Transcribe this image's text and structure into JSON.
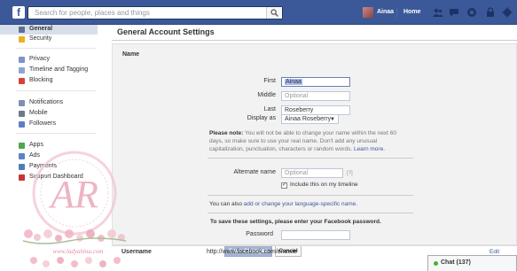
{
  "topbar": {
    "logo": "f",
    "search_placeholder": "Search for people, places and things",
    "user_name": "Ainaa",
    "home_label": "Home",
    "icons": [
      "search-icon",
      "friend-requests-icon",
      "messages-icon",
      "notifications-icon",
      "privacy-lock-icon",
      "settings-gear-icon"
    ],
    "color": "#3b5998"
  },
  "sidebar": {
    "items": [
      {
        "label": "General",
        "icon": "gear-icon",
        "color": "#5f6f8f",
        "active": true
      },
      {
        "label": "Security",
        "icon": "security-icon",
        "color": "#e8b21c"
      },
      {
        "label": "Privacy",
        "icon": "privacy-icon",
        "color": "#7a94c8"
      },
      {
        "label": "Timeline and Tagging",
        "icon": "timeline-icon",
        "color": "#8fa5cf"
      },
      {
        "label": "Blocking",
        "icon": "blocking-icon",
        "color": "#d8413a"
      },
      {
        "label": "Notifications",
        "icon": "notifications-icon",
        "color": "#7e8fb2"
      },
      {
        "label": "Mobile",
        "icon": "mobile-icon",
        "color": "#6d7a90"
      },
      {
        "label": "Followers",
        "icon": "followers-icon",
        "color": "#5b80c0"
      },
      {
        "label": "Apps",
        "icon": "apps-icon",
        "color": "#4fa84a"
      },
      {
        "label": "Ads",
        "icon": "ads-icon",
        "color": "#5b84c4"
      },
      {
        "label": "Payments",
        "icon": "payments-icon",
        "color": "#4f7bb8"
      },
      {
        "label": "Support Dashboard",
        "icon": "support-icon",
        "color": "#c33"
      }
    ]
  },
  "main": {
    "title": "General Account Settings",
    "name_section": {
      "label": "Name",
      "first_label": "First",
      "first_value": "Ainaa",
      "middle_label": "Middle",
      "middle_placeholder": "Optional",
      "last_label": "Last",
      "last_value": "Roseberry",
      "display_label": "Display as",
      "display_value": "Ainaa Roseberry",
      "note_bold": "Please note:",
      "note_text": " You will not be able to change your name within the next 60 days, so make sure to use your real name. Don't add any unusual capitalization, punctuation, characters or random words. ",
      "note_link": "Learn more.",
      "alt_label": "Alternate name",
      "alt_placeholder": "Optional",
      "alt_hint": "[?]",
      "include_label": "Include this on my timeline",
      "include_checked": true,
      "lang_text": "You can also ",
      "lang_link": "add or change your language-specific name.",
      "save_prompt": "To save these settings, please enter your Facebook password.",
      "password_label": "Password",
      "save_button": "Save Changes",
      "cancel_button": "Cancel"
    },
    "username_section": {
      "label": "Username",
      "value": "http://www.facebook.com/enawie",
      "edit": "Edit"
    }
  },
  "chat": {
    "label": "Chat (137)",
    "status_color": "#42b72a"
  },
  "watermark": {
    "monogram": "AR",
    "url": "www.ladyahina.com"
  }
}
